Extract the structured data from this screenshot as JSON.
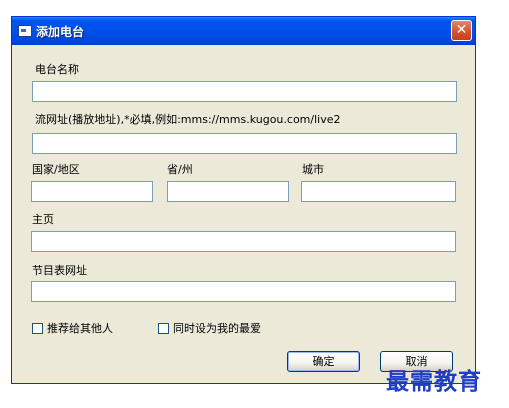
{
  "window": {
    "title": "添加电台",
    "close_icon": "close-icon",
    "title_icon": "app-icon"
  },
  "form": {
    "station_name_label": "电台名称",
    "station_name_value": "",
    "stream_url_label": "流网址(播放地址),*必填,例如:mms://mms.kugou.com/live2",
    "stream_url_value": "",
    "country_label": "国家/地区",
    "country_value": "",
    "province_label": "省/州",
    "province_value": "",
    "city_label": "城市",
    "city_value": "",
    "homepage_label": "主页",
    "homepage_value": "",
    "schedule_url_label": "节目表网址",
    "schedule_url_value": ""
  },
  "options": {
    "recommend_label": "推荐给其他人",
    "recommend_checked": false,
    "favorite_label": "同时设为我的最爱",
    "favorite_checked": false
  },
  "buttons": {
    "ok_label": "确定",
    "cancel_label": "取消"
  },
  "watermark": {
    "text": "最需教育"
  }
}
